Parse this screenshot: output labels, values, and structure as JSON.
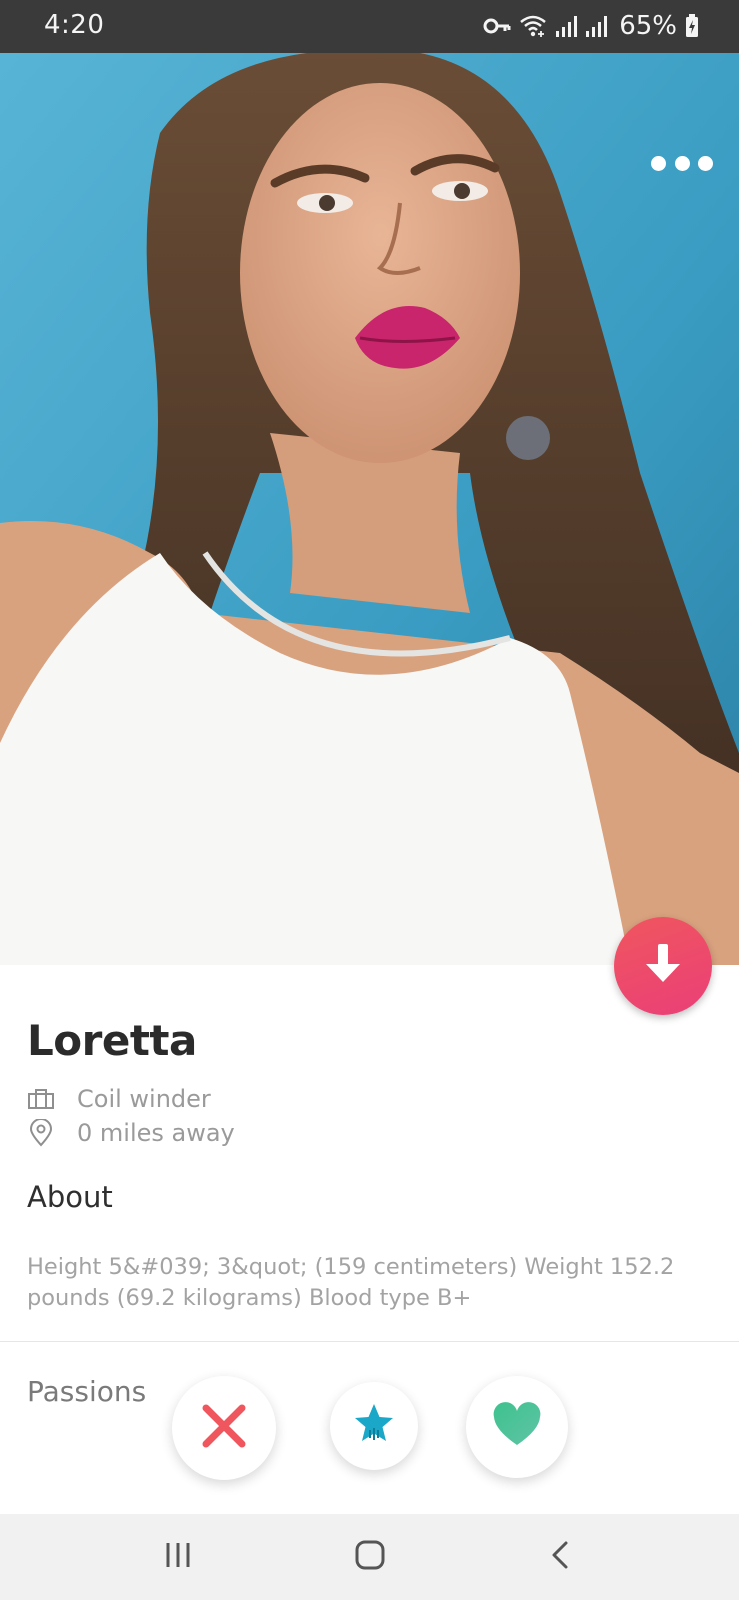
{
  "status_bar": {
    "time": "4:20",
    "battery": "65%",
    "icons": [
      "vpn-key-icon",
      "wifi-icon",
      "signal-icon",
      "signal-icon",
      "battery-charging-icon"
    ]
  },
  "profile": {
    "name": "Loretta",
    "job": "Coil winder",
    "distance": "0 miles away",
    "job_icon": "briefcase-icon",
    "distance_icon": "location-pin-icon"
  },
  "about": {
    "heading": "About",
    "text": "Height 5&#039; 3&quot; (159 centimeters) Weight 152.2 pounds (69.2 kilograms) Blood type B+"
  },
  "passions": {
    "heading": "Passions"
  },
  "actions": {
    "nope": "close-icon",
    "super_like": "star-icon",
    "like": "heart-icon"
  },
  "colors": {
    "accent": "#ef4a6b",
    "nope": "#f0565e",
    "super_like": "#1aa7c8",
    "like": "#46c498",
    "status_bar": "#3a3a3a"
  },
  "nav": {
    "icons": [
      "recent-apps-icon",
      "home-icon",
      "back-icon"
    ]
  }
}
